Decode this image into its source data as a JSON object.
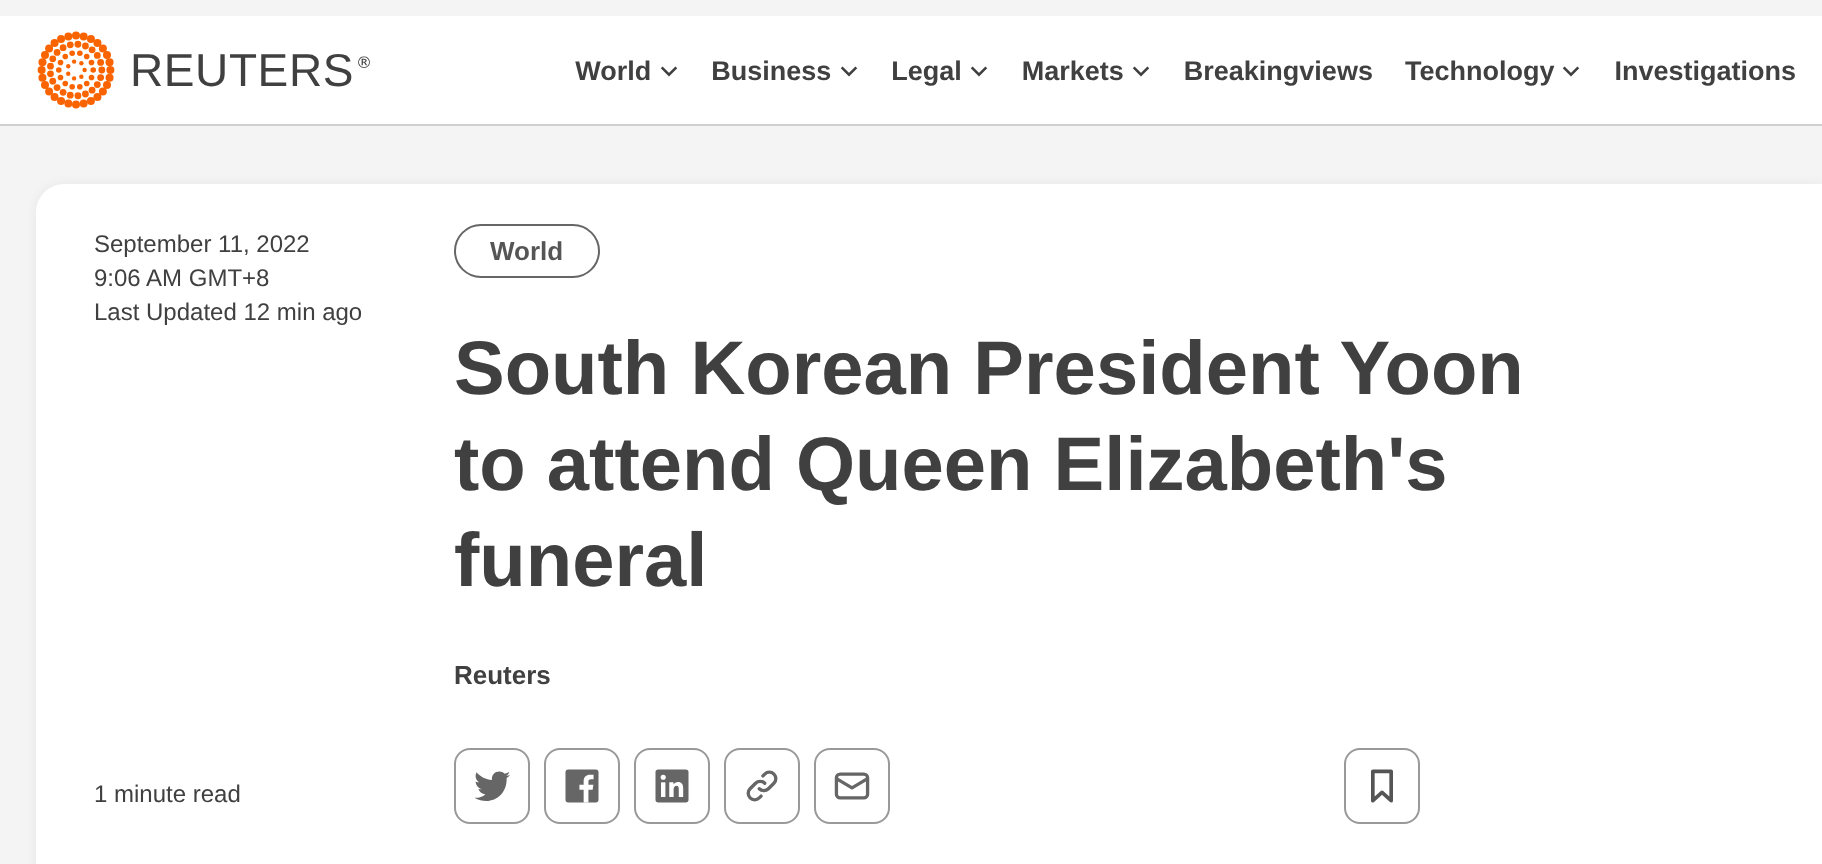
{
  "header": {
    "logo": {
      "name": "REUTERS",
      "mark": "®"
    },
    "nav": [
      {
        "label": "World",
        "dropdown": true
      },
      {
        "label": "Business",
        "dropdown": true
      },
      {
        "label": "Legal",
        "dropdown": true
      },
      {
        "label": "Markets",
        "dropdown": true
      },
      {
        "label": "Breakingviews",
        "dropdown": false
      },
      {
        "label": "Technology",
        "dropdown": true
      },
      {
        "label": "Investigations",
        "dropdown": false
      }
    ]
  },
  "article": {
    "date": "September 11, 2022",
    "time": "9:06 AM GMT+8",
    "updated": "Last Updated 12 min ago",
    "section": "World",
    "headline": "South Korean President Yoon to attend Queen Elizabeth's funeral",
    "byline": "Reuters",
    "read_time": "1 minute read",
    "share": [
      {
        "kind": "twitter"
      },
      {
        "kind": "facebook"
      },
      {
        "kind": "linkedin"
      },
      {
        "kind": "link"
      },
      {
        "kind": "email"
      }
    ],
    "save": {
      "kind": "bookmark"
    }
  }
}
